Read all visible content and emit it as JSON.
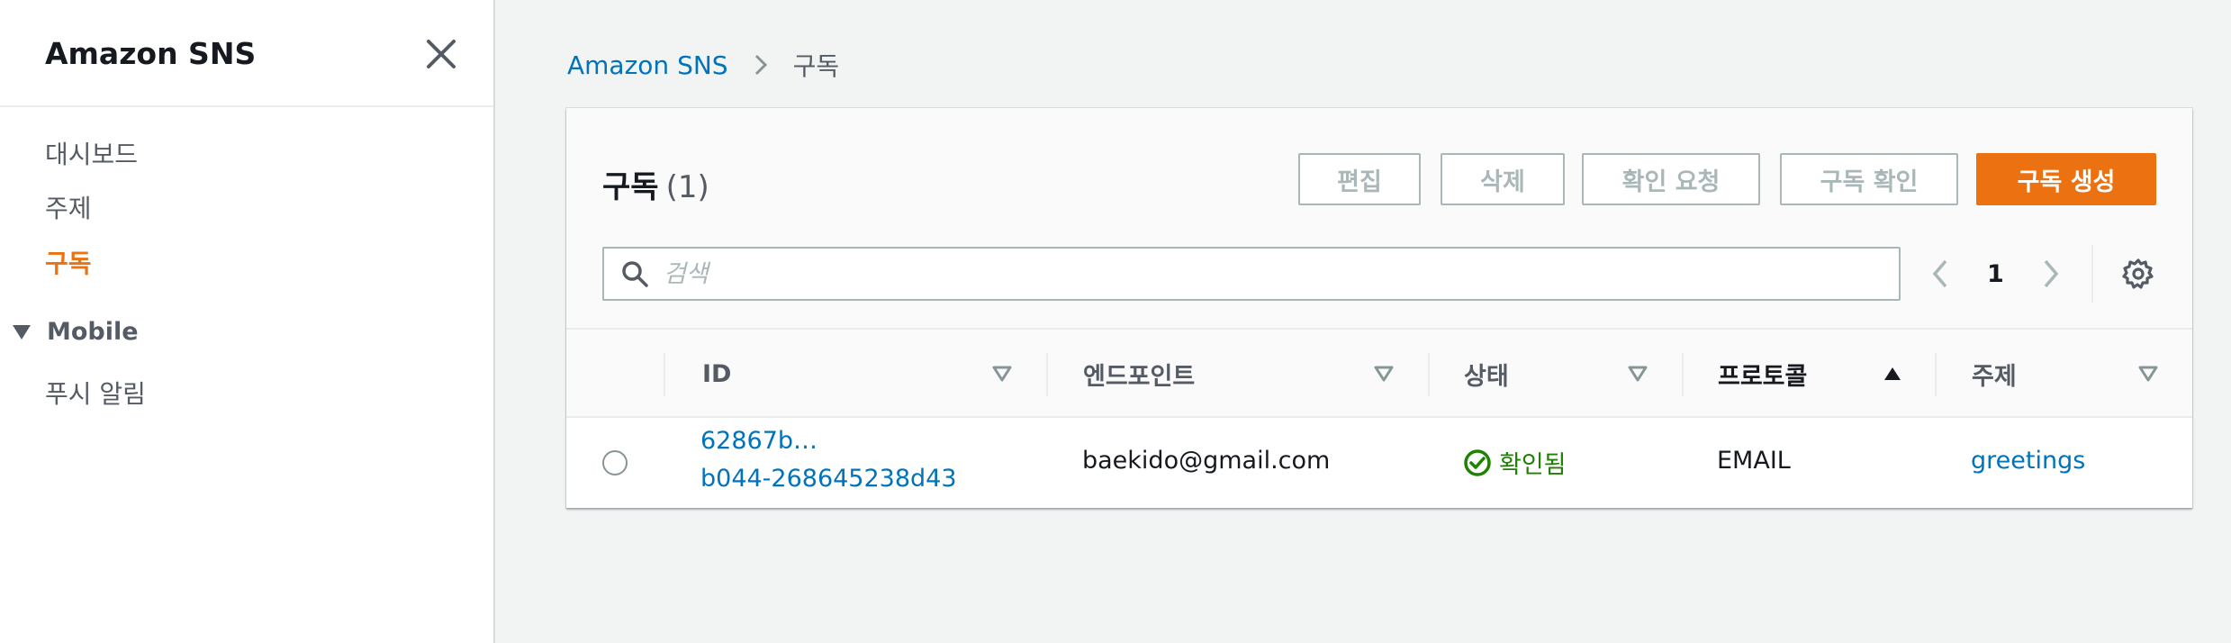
{
  "sidebar": {
    "title": "Amazon SNS",
    "items": [
      {
        "label": "대시보드"
      },
      {
        "label": "주제"
      },
      {
        "label": "구독"
      }
    ],
    "section": {
      "label": "Mobile",
      "items": [
        {
          "label": "푸시 알림"
        }
      ]
    }
  },
  "breadcrumb": {
    "root": "Amazon SNS",
    "current": "구독"
  },
  "panel": {
    "title": "구독",
    "count": "(1)",
    "buttons": {
      "edit": "편집",
      "delete": "삭제",
      "request_confirmation": "확인 요청",
      "confirm_subscription": "구독 확인",
      "create_subscription": "구독 생성"
    },
    "search": {
      "placeholder": "검색",
      "value": ""
    },
    "pagination": {
      "current_page": "1"
    }
  },
  "table": {
    "columns": [
      {
        "label": "ID"
      },
      {
        "label": "엔드포인트"
      },
      {
        "label": "상태"
      },
      {
        "label": "프로토콜"
      },
      {
        "label": "주제"
      }
    ],
    "rows": [
      {
        "id_line1": "62867b…",
        "id_line2": "b044-268645238d43",
        "endpoint": "baekido@gmail.com",
        "status": "확인됨",
        "protocol": "EMAIL",
        "topic": "greetings"
      }
    ]
  },
  "colors": {
    "accent": "#ec7211",
    "link": "#0073bb",
    "success": "#1d8102"
  }
}
